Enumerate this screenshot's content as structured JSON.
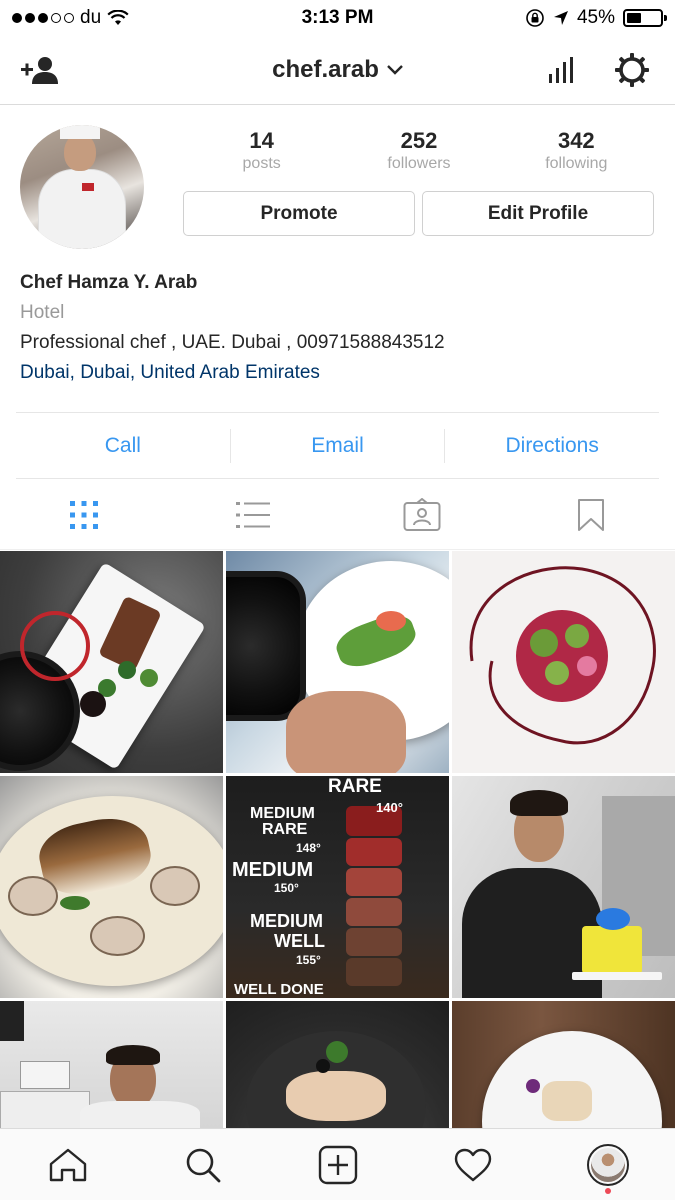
{
  "status_bar": {
    "carrier": "du",
    "time": "3:13 PM",
    "battery_percent": "45%",
    "signal_bars_filled": 3,
    "signal_bars_total": 5,
    "battery_level": 0.45
  },
  "nav": {
    "username": "chef.arab",
    "add_person_icon": "add-person-icon",
    "chevron_icon": "chevron-down-icon",
    "insights_icon": "insights-icon",
    "settings_icon": "gear-icon"
  },
  "profile": {
    "stats": [
      {
        "count": "14",
        "label": "posts"
      },
      {
        "count": "252",
        "label": "followers"
      },
      {
        "count": "342",
        "label": "following"
      }
    ],
    "promote_label": "Promote",
    "edit_profile_label": "Edit Profile",
    "name": "Chef Hamza Y. Arab",
    "category": "Hotel",
    "bio": "Professional chef , UAE. Dubai , 00971588843512",
    "location": "Dubai, Dubai, United Arab Emirates"
  },
  "contact": {
    "call": "Call",
    "email": "Email",
    "directions": "Directions"
  },
  "view_tabs": [
    {
      "icon": "grid-icon",
      "active": true
    },
    {
      "icon": "list-icon",
      "active": false
    },
    {
      "icon": "tagged-icon",
      "active": false
    },
    {
      "icon": "bookmark-icon",
      "active": false
    }
  ],
  "grid": {
    "tile_4_text": {
      "rare": "RARE",
      "rare_temp": "140°",
      "medium_rare": [
        "MEDIUM",
        "RARE"
      ],
      "medium_rare_temp": "148°",
      "medium": "MEDIUM",
      "medium_temp": "150°",
      "medium_well": [
        "MEDIUM",
        "WELL"
      ],
      "medium_well_temp": "155°",
      "well_done": "WELL DONE"
    }
  },
  "tab_bar": [
    {
      "icon": "home-icon"
    },
    {
      "icon": "search-icon"
    },
    {
      "icon": "add-post-icon"
    },
    {
      "icon": "heart-icon"
    },
    {
      "icon": "profile-avatar"
    }
  ],
  "colors": {
    "accent_blue": "#3897f0",
    "location_blue": "#003569",
    "notification_red": "#ed4956"
  }
}
